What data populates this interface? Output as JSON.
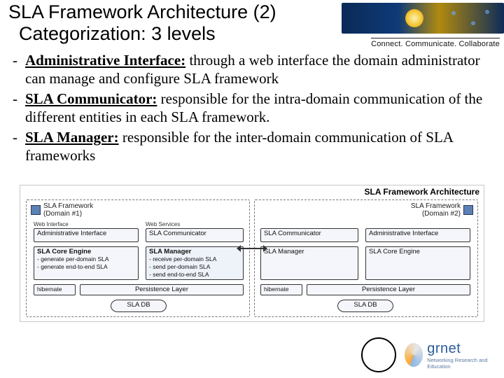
{
  "header": {
    "title_line1": "SLA Framework Architecture (2)",
    "title_line2": "Categorization: 3 levels",
    "tagline": "Connect. Communicate. Collaborate"
  },
  "bullets": [
    {
      "key": "Administrative Interface:",
      "rest": " through a web interface the domain administrator can manage and configure SLA framework"
    },
    {
      "key": "SLA Communicator:",
      "rest": " responsible for the intra-domain communication of the different entities in each SLA framework."
    },
    {
      "key": "SLA Manager:",
      "rest": " responsible for the inter-domain communication of SLA frameworks"
    }
  ],
  "diagram": {
    "title": "SLA Framework Architecture",
    "domain_left": {
      "label_l1": "SLA Framework",
      "label_l2": "(Domain #1)"
    },
    "domain_right": {
      "label_l1": "SLA Framework",
      "label_l2": "(Domain #2)"
    },
    "labels": {
      "web_interface": "Web Interface",
      "web_services": "Web Services",
      "admin_interface": "Administrative Interface",
      "sla_communicator": "SLA Communicator",
      "sla_manager": "SLA Manager",
      "sla_core_engine": "SLA Core Engine",
      "hibernate": "hibernate",
      "persistence_layer": "Persistence Layer",
      "sla_db": "SLA DB"
    },
    "core_notes_l1": "- generate per-domain SLA",
    "core_notes_l2": "- generate end-to-end SLA",
    "mgr_notes_l1": "- receive per-domain SLA",
    "mgr_notes_l2": "- send per-domain SLA",
    "mgr_notes_l3": "- send end-to-end SLA"
  },
  "footer": {
    "logo2_name": "grnet",
    "logo2_sub": "Networking Research and Education"
  }
}
